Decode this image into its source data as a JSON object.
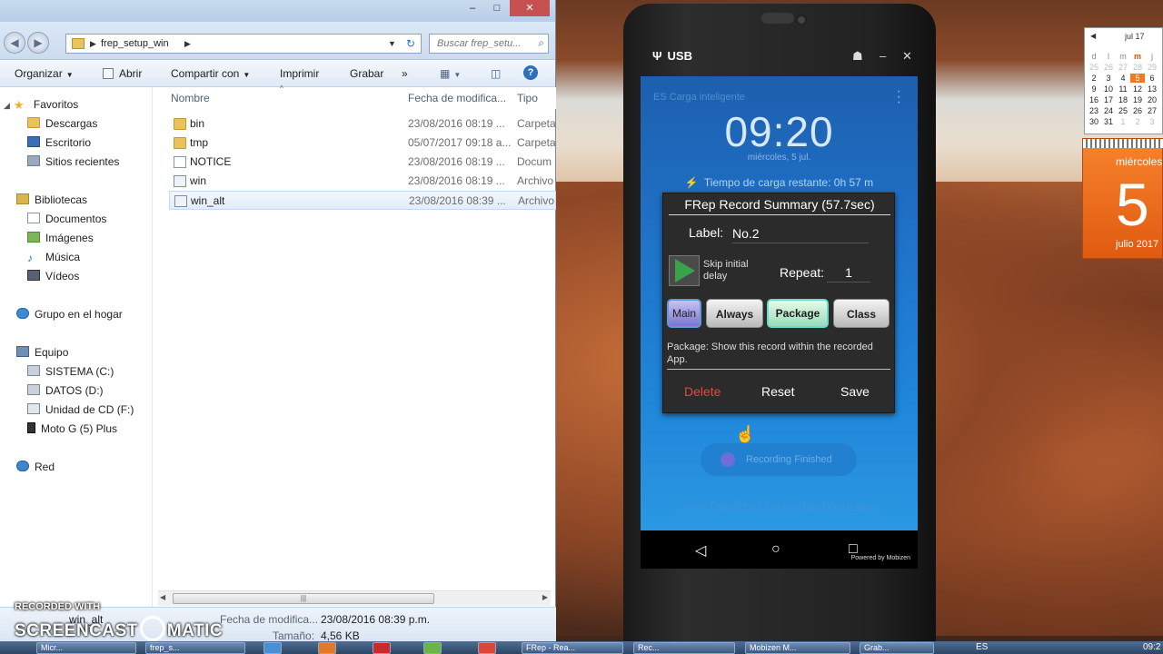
{
  "explorer": {
    "address_path": "frep_setup_win",
    "search_placeholder": "Buscar frep_setu...",
    "toolbar": {
      "organize": "Organizar",
      "open": "Abrir",
      "share": "Compartir con",
      "print": "Imprimir",
      "burn": "Grabar",
      "more": "»"
    },
    "nav": {
      "favorites": "Favoritos",
      "downloads": "Descargas",
      "desktop": "Escritorio",
      "recent": "Sitios recientes",
      "libraries": "Bibliotecas",
      "documents": "Documentos",
      "images": "Imágenes",
      "music": "Música",
      "videos": "Vídeos",
      "homegroup": "Grupo en el hogar",
      "computer": "Equipo",
      "drive_c": "SISTEMA (C:)",
      "drive_d": "DATOS (D:)",
      "drive_f": "Unidad de CD (F:)",
      "device": "Moto G (5) Plus",
      "network": "Red"
    },
    "columns": {
      "name": "Nombre",
      "date": "Fecha de modifica...",
      "type": "Tipo"
    },
    "files": [
      {
        "name": "bin",
        "date": "23/08/2016 08:19 ...",
        "type": "Carpeta",
        "icon": "folder-icon"
      },
      {
        "name": "tmp",
        "date": "05/07/2017 09:18 a...",
        "type": "Carpeta",
        "icon": "folder-icon"
      },
      {
        "name": "NOTICE",
        "date": "23/08/2016 08:19 ...",
        "type": "Docum",
        "icon": "document-icon"
      },
      {
        "name": "win",
        "date": "23/08/2016 08:19 ...",
        "type": "Archivo",
        "icon": "config-file-icon"
      },
      {
        "name": "win_alt",
        "date": "23/08/2016 08:39 ...",
        "type": "Archivo",
        "icon": "config-file-icon"
      }
    ],
    "details": {
      "name": "win_alt",
      "date_label": "Fecha de modifica...",
      "date_value": "23/08/2016 08:39 p.m.",
      "size_label": "Tamaño:",
      "size_value": "4,56 KB"
    }
  },
  "watermark": {
    "line1": "RECORDED WITH",
    "line2a": "SCREENCAST",
    "line2b": "MATIC"
  },
  "phone": {
    "usb_label": "USB",
    "lock_screen": {
      "charge_label": "ES Carga inteligente",
      "clock": "09:20",
      "date": "miércoles, 5 jul.",
      "charge_time": "Tiempo de carga restante: 0h 57 m",
      "recording_finished": "Recording Finished",
      "slide_hint": ">>> Deslizar para desbloquear"
    },
    "dialog": {
      "title": "FRep Record Summary (57.7sec)",
      "label_caption": "Label:",
      "label_value": "No.2",
      "skip_text": "Skip initial delay",
      "repeat_caption": "Repeat:",
      "repeat_value": "1",
      "modes": [
        "Main",
        "Always",
        "Package",
        "Class"
      ],
      "selected_mode": "Package",
      "package_desc": "Package: Show this record within the recorded App.",
      "delete": "Delete",
      "reset": "Reset",
      "save": "Save"
    },
    "powered_by": "Powered by Mobizen"
  },
  "calendar": {
    "month_label": "jul 17",
    "weekday_header": [
      "d",
      "l",
      "m",
      "m",
      "j"
    ],
    "rows": [
      [
        "25",
        "26",
        "27",
        "28",
        "29"
      ],
      [
        "2",
        "3",
        "4",
        "5",
        "6"
      ],
      [
        "9",
        "10",
        "11",
        "12",
        "13"
      ],
      [
        "16",
        "17",
        "18",
        "19",
        "20"
      ],
      [
        "23",
        "24",
        "25",
        "26",
        "27"
      ],
      [
        "30",
        "31",
        "1",
        "2",
        "3"
      ]
    ],
    "today": "5",
    "day_weekday": "miércoles",
    "day_number": "5",
    "day_month": "julio 2017"
  },
  "taskbar": {
    "tasks": [
      "Micr...",
      "frep_s...",
      "FRep - Rea...",
      "Rec...",
      "Mobizen M...",
      "Grab..."
    ],
    "lang": "ES",
    "time": "09:2"
  },
  "colors": {
    "accent": "#f07a22",
    "delete_red": "#e8463e",
    "screen_blue": "#1f72c8"
  }
}
